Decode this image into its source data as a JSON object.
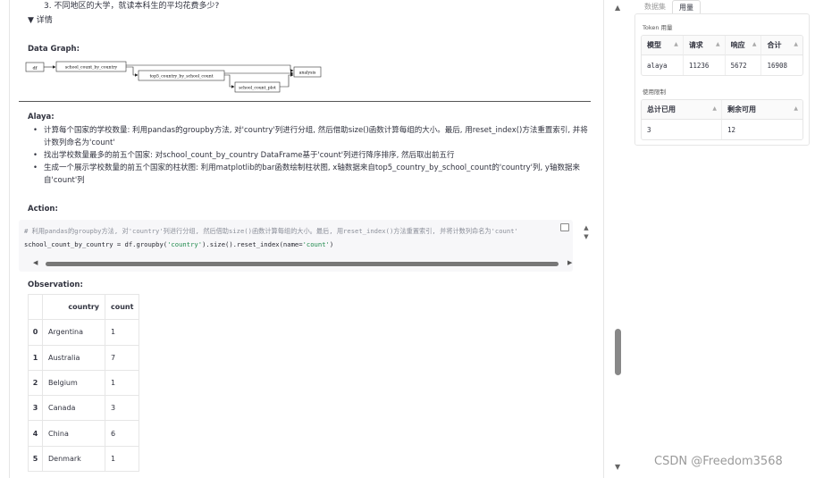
{
  "question_lines": [
    "3. 不同地区的大学，就读本科生的平均花费多少?"
  ],
  "details_toggle": "▼ 详情",
  "data_graph": {
    "title": "Data Graph:",
    "nodes": [
      "df",
      "school_count_by_country",
      "top5_country_by_school_count",
      "analysis",
      "school_count_plot"
    ]
  },
  "alaya": {
    "label": "Alaya:",
    "steps": [
      "计算每个国家的学校数量: 利用pandas的groupby方法, 对'country'列进行分组, 然后借助size()函数计算每组的大小。最后, 用reset_index()方法重置索引, 并将计数列命名为'count'",
      "找出学校数量最多的前五个国家: 对school_count_by_country DataFrame基于'count'列进行降序排序, 然后取出前五行",
      "生成一个展示学校数量的前五个国家的柱状图: 利用matplotlib的bar函数绘制柱状图, x轴数据来自top5_country_by_school_count的'country'列, y轴数据来自'count'列"
    ]
  },
  "action": {
    "label": "Action:",
    "comment": "# 利用pandas的groupby方法, 对'country'列进行分组, 然后借助size()函数计算每组的大小。最后, 用reset_index()方法重置索引, 并将计数列命名为'count'",
    "code_prefix": "school_count_by_country = df.groupby(",
    "code_str1": "'country'",
    "code_mid": ").size().reset_index(name=",
    "code_str2": "'count'",
    "code_suffix": ")"
  },
  "observation": {
    "label": "Observation:",
    "headers": [
      "",
      "country",
      "count"
    ],
    "rows": [
      [
        "0",
        "Argentina",
        "1"
      ],
      [
        "1",
        "Australia",
        "7"
      ],
      [
        "2",
        "Belgium",
        "1"
      ],
      [
        "3",
        "Canada",
        "3"
      ],
      [
        "4",
        "China",
        "6"
      ],
      [
        "5",
        "Denmark",
        "1"
      ]
    ]
  },
  "right": {
    "tabs": [
      "数据集",
      "用量"
    ],
    "token_label": "Token 用量",
    "token_table": {
      "headers": [
        "模型",
        "请求",
        "响应",
        "合计"
      ],
      "row": [
        "alaya",
        "11236",
        "5672",
        "16908"
      ]
    },
    "limit_label": "使用限制",
    "limit_table": {
      "headers": [
        "总计已用",
        "剩余可用"
      ],
      "row": [
        "3",
        "12"
      ]
    }
  },
  "watermark": "CSDN @Freedom3568",
  "icons": {
    "sort": "sort-arrow-icon",
    "copy": "copy-icon"
  }
}
